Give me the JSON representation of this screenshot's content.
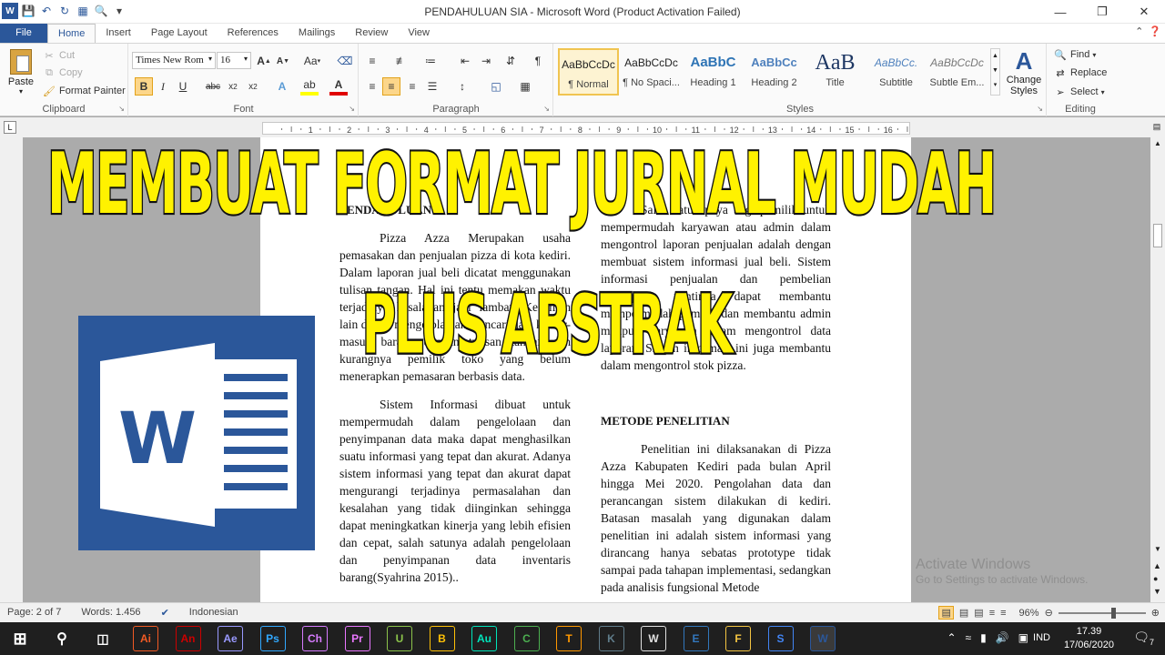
{
  "window": {
    "title": "PENDAHULUAN SIA  -  Microsoft Word (Product Activation Failed)"
  },
  "tabs": [
    "File",
    "Home",
    "Insert",
    "Page Layout",
    "References",
    "Mailings",
    "Review",
    "View"
  ],
  "active_tab": "Home",
  "clipboard": {
    "paste": "Paste",
    "cut": "Cut",
    "copy": "Copy",
    "format_painter": "Format Painter",
    "label": "Clipboard"
  },
  "font": {
    "name": "Times New Rom",
    "size": "16",
    "label": "Font"
  },
  "paragraph": {
    "label": "Paragraph"
  },
  "styles": {
    "label": "Styles",
    "change_styles": "Change Styles",
    "items": [
      {
        "preview": "AaBbCcDc",
        "name": "¶ Normal"
      },
      {
        "preview": "AaBbCcDc",
        "name": "¶ No Spaci..."
      },
      {
        "preview": "AaBbC",
        "name": "Heading 1"
      },
      {
        "preview": "AaBbCc",
        "name": "Heading 2"
      },
      {
        "preview": "AaB",
        "name": "Title"
      },
      {
        "preview": "AaBbCc.",
        "name": "Subtitle"
      },
      {
        "preview": "AaBbCcDc",
        "name": "Subtle Em..."
      }
    ]
  },
  "editing": {
    "find": "Find",
    "replace": "Replace",
    "select": "Select",
    "label": "Editing"
  },
  "ruler_numbers": [
    "1",
    "2",
    "3",
    "4",
    "5",
    "6",
    "7",
    "8",
    "9",
    "10",
    "11",
    "12",
    "13",
    "14",
    "15",
    "16"
  ],
  "document": {
    "left_heading": "PENDAHULUAN",
    "left_p1": "Pizza Azza Merupakan usaha pemasakan dan penjualan pizza di kota kediri. Dalam laporan jual beli dicatat menggunakan tulisan tangan. Hal ini tentu memakan waktu terjadinya kesalahan jadi lambat. Kesulitan lain dalam mengelola dan mencari data keluar-masuk barang dengan tulisan tangan dan kurangnya pemilik toko yang belum menerapkan pemasaran berbasis data.",
    "left_p2": "Sistem Informasi dibuat untuk mempermudah dalam pengelolaan dan penyimpanan data maka dapat menghasilkan suatu informasi yang tepat dan akurat. Adanya sistem informasi yang tepat dan akurat dapat mengurangi terjadinya permasalahan dan kesalahan yang tidak diinginkan sehingga dapat meningkatkan kinerja yang lebih efisien dan cepat, salah satunya adalah pengelolaan dan penyimpanan data inventaris barang(Syahrina 2015)..",
    "right_p1": "Salah satu upaya bagi pemilik untuk mempermudah karyawan atau admin dalam mengontrol laporan penjualan adalah dengan membuat sistem informasi jual beli. Sistem informasi penjualan dan pembelian diharapkan nantinya dapat membantu mempermudah pemilik dan membantu admin maupun karyawan dalam mengontrol data laporan. Sistem informasi ini juga membantu dalam mengontrol stok pizza.",
    "right_heading": "METODE PENELITIAN",
    "right_p2": "Penelitian ini dilaksanakan di Pizza Azza Kabupaten Kediri pada bulan April hingga Mei 2020. Pengolahan data dan perancangan sistem dilakukan di kediri. Batasan masalah yang digunakan dalam penelitian ini adalah sistem informasi yang dirancang hanya sebatas prototype tidak sampai pada tahapan implementasi, sedangkan pada analisis fungsional Metode"
  },
  "overlay": {
    "line1": "MEMBUAT FORMAT JURNAL MUDAH",
    "line2": "PLUS ABSTRAK"
  },
  "watermark": {
    "line1": "Activate Windows",
    "line2": "Go to Settings to activate Windows."
  },
  "status": {
    "page": "Page: 2 of 7",
    "words": "Words: 1.456",
    "language": "Indonesian",
    "zoom": "96%"
  },
  "taskbar": {
    "lang": "IND",
    "time": "17.39",
    "date": "17/06/2020",
    "notif_count": "7",
    "apps": [
      {
        "label": "Ai",
        "color": "#f15a24"
      },
      {
        "label": "An",
        "color": "#cc0000"
      },
      {
        "label": "Ae",
        "color": "#9999ff"
      },
      {
        "label": "Ps",
        "color": "#31a8ff"
      },
      {
        "label": "Ch",
        "color": "#d67bff"
      },
      {
        "label": "Pr",
        "color": "#ea77ff"
      },
      {
        "label": "U",
        "color": "#8bc34a"
      },
      {
        "label": "B",
        "color": "#ffc107"
      },
      {
        "label": "Au",
        "color": "#00e4bb"
      },
      {
        "label": "C",
        "color": "#4caf50"
      },
      {
        "label": "T",
        "color": "#ff9800"
      },
      {
        "label": "K",
        "color": "#607d8b"
      },
      {
        "label": "W",
        "color": "#e0e0e0"
      },
      {
        "label": "E",
        "color": "#3277bc"
      },
      {
        "label": "F",
        "color": "#f4c542"
      },
      {
        "label": "S",
        "color": "#4285f4"
      },
      {
        "label": "W",
        "color": "#2b579a"
      }
    ]
  }
}
